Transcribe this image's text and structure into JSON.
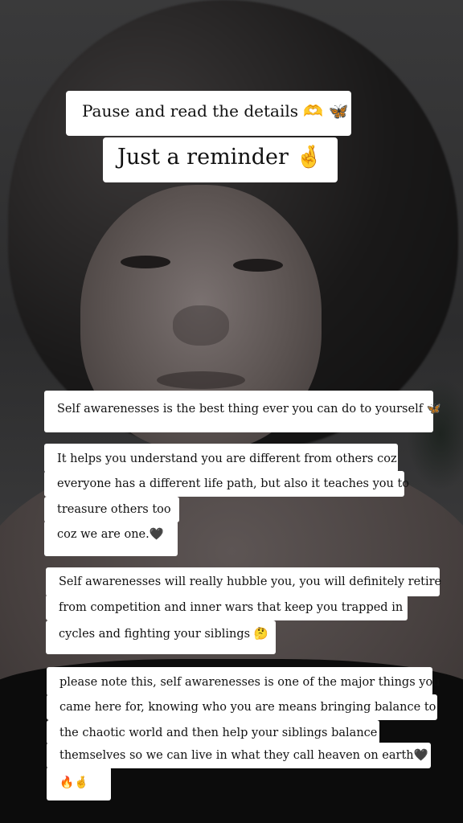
{
  "captions": {
    "title1": "Pause and read the details 🫶 🦋",
    "title2": "Just a reminder 🤞"
  },
  "notes": [
    {
      "lines": [
        "Self awarenesses is the best thing ever you can do to yourself 🦋"
      ]
    },
    {
      "lines": [
        "It helps you understand you are different from others coz",
        "everyone has a different life path, but also it teaches you to",
        "treasure others too",
        " coz we are one.🖤"
      ]
    },
    {
      "lines": [
        "Self awarenesses will really hubble you, you will definitely retire",
        "from competition and inner wars that keep you trapped in",
        "cycles and fighting your siblings 🤔"
      ]
    },
    {
      "lines": [
        "please note this, self awarenesses is one of the major things you",
        "came here for, knowing who you are means bringing balance to",
        "the chaotic world and then help your siblings balance",
        "themselves so we can live in what they call heaven on earth🖤",
        "🔥🤞"
      ]
    }
  ]
}
